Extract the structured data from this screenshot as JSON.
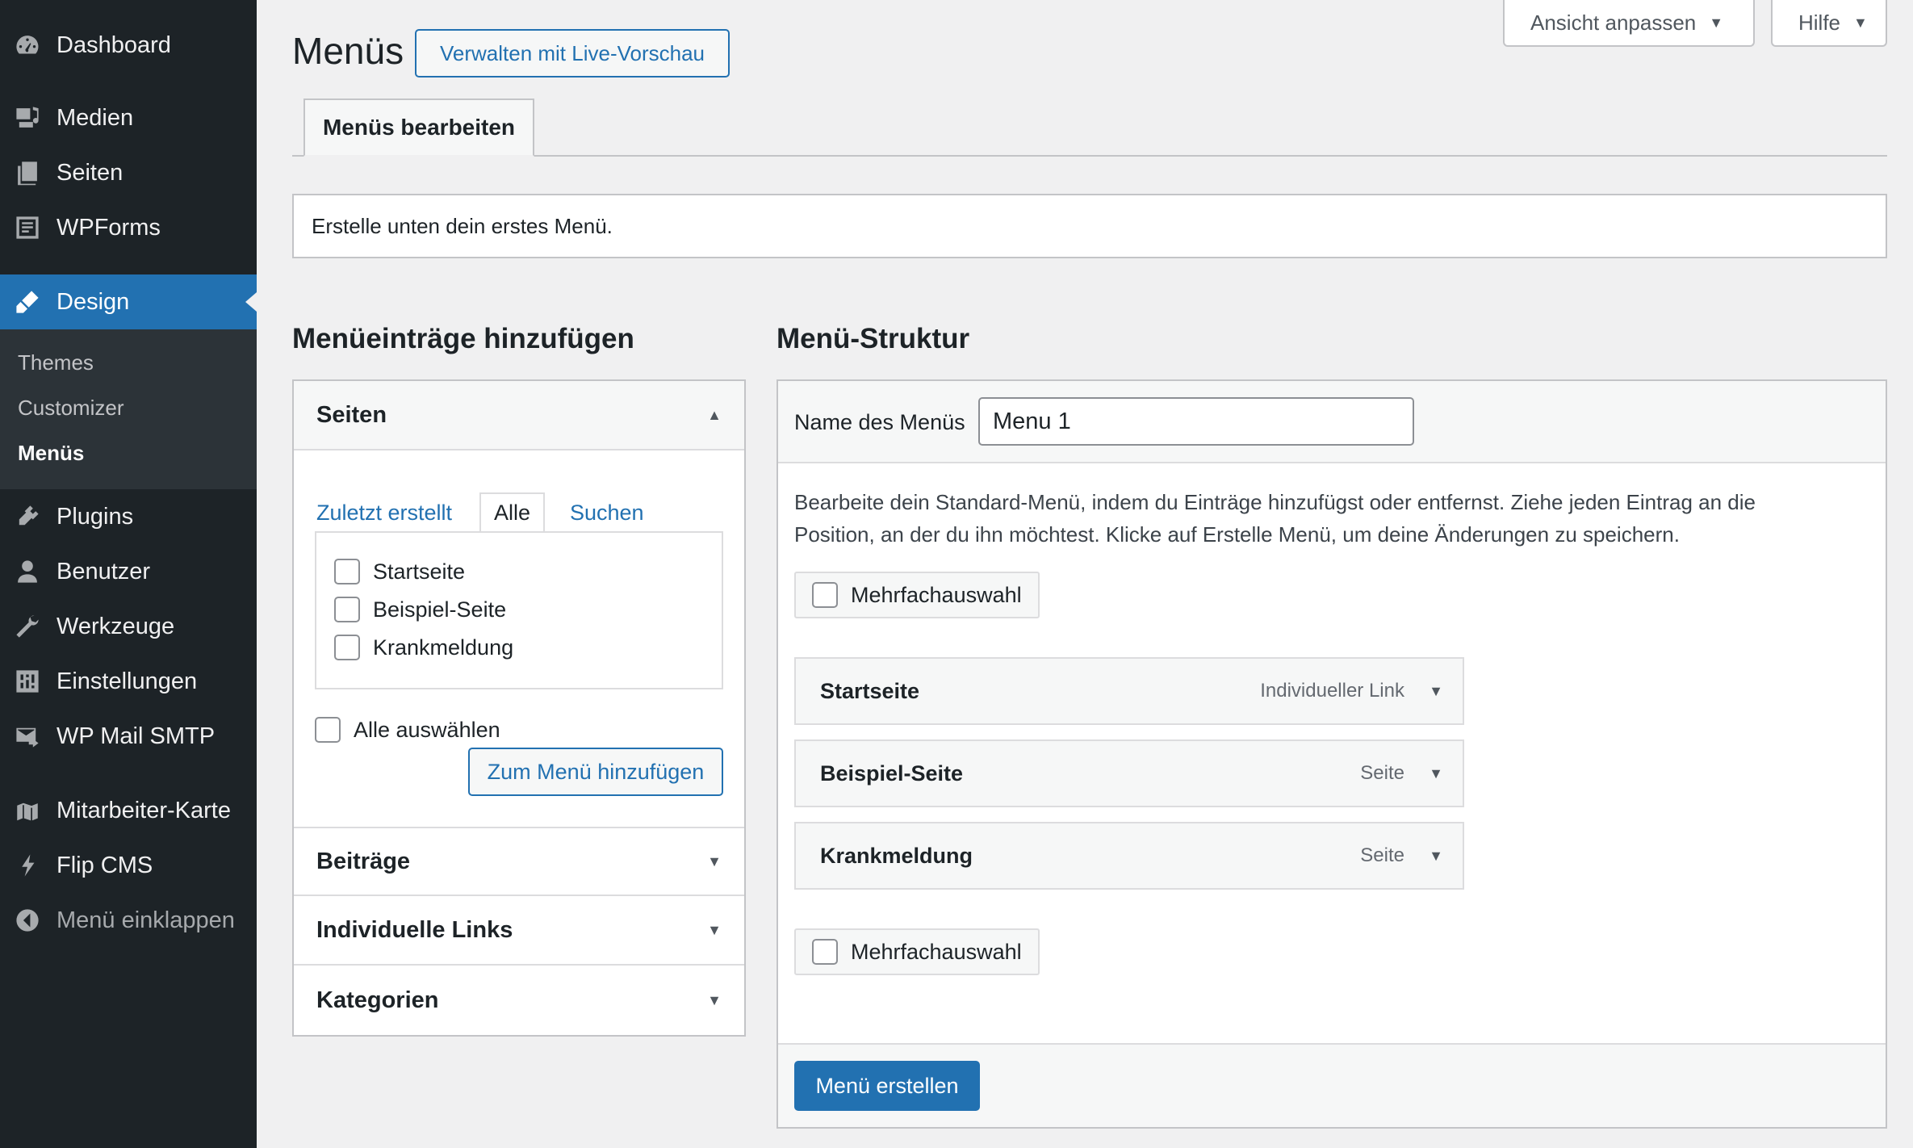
{
  "sidebar": {
    "items": [
      {
        "label": "Dashboard",
        "icon": "dashboard-icon"
      },
      {
        "label": "Medien",
        "icon": "media-icon"
      },
      {
        "label": "Seiten",
        "icon": "pages-icon"
      },
      {
        "label": "WPForms",
        "icon": "wpforms-icon"
      },
      {
        "label": "Design",
        "icon": "appearance-icon"
      },
      {
        "label": "Plugins",
        "icon": "plugins-icon"
      },
      {
        "label": "Benutzer",
        "icon": "users-icon"
      },
      {
        "label": "Werkzeuge",
        "icon": "tools-icon"
      },
      {
        "label": "Einstellungen",
        "icon": "settings-icon"
      },
      {
        "label": "WP Mail SMTP",
        "icon": "mail-icon"
      },
      {
        "label": "Mitarbeiter-Karte",
        "icon": "map-icon"
      },
      {
        "label": "Flip CMS",
        "icon": "flip-icon"
      },
      {
        "label": "Menü einklappen",
        "icon": "collapse-icon"
      }
    ],
    "submenu": [
      "Themes",
      "Customizer",
      "Menüs"
    ],
    "active_color": "#2271b1"
  },
  "header": {
    "title": "Menüs",
    "live_preview_button": "Verwalten mit Live-Vorschau",
    "screen_options": "Ansicht anpassen",
    "help": "Hilfe",
    "tab": "Menüs bearbeiten"
  },
  "notice": "Erstelle unten dein erstes Menü.",
  "add_items": {
    "title": "Menüeinträge hinzufügen",
    "sections": [
      "Seiten",
      "Beiträge",
      "Individuelle Links",
      "Kategorien"
    ],
    "tabs": [
      "Zuletzt erstellt",
      "Alle",
      "Suchen"
    ],
    "pages": [
      "Startseite",
      "Beispiel-Seite",
      "Krankmeldung"
    ],
    "select_all": "Alle auswählen",
    "add_button": "Zum Menü hinzufügen"
  },
  "structure": {
    "title": "Menü-Struktur",
    "name_label": "Name des Menüs",
    "name_value": "Menu 1",
    "description_line1": "Bearbeite dein Standard-Menü, indem du Einträge hinzufügst oder entfernst. Ziehe jeden Eintrag an die",
    "description_line2": "Position, an der du ihn möchtest. Klicke auf Erstelle Menü, um deine Änderungen zu speichern.",
    "bulk_select": "Mehrfachauswahl",
    "items": [
      {
        "title": "Startseite",
        "type": "Individueller Link"
      },
      {
        "title": "Beispiel-Seite",
        "type": "Seite"
      },
      {
        "title": "Krankmeldung",
        "type": "Seite"
      }
    ],
    "save_button": "Menü erstellen"
  }
}
